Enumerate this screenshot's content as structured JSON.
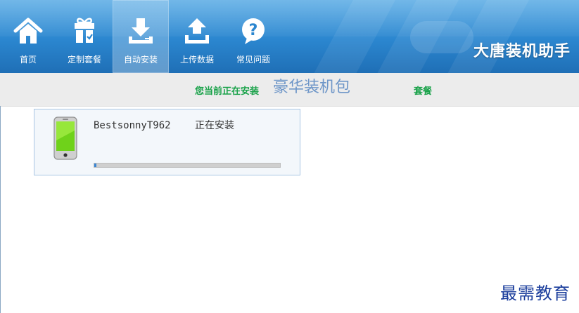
{
  "nav": {
    "items": [
      {
        "label": "首页",
        "icon": "home-icon"
      },
      {
        "label": "定制套餐",
        "icon": "gift-icon"
      },
      {
        "label": "自动安装",
        "icon": "download-icon",
        "active": true
      },
      {
        "label": "上传数据",
        "icon": "upload-icon"
      },
      {
        "label": "常见问题",
        "icon": "question-icon"
      }
    ]
  },
  "brand": "大唐装机助手",
  "status": {
    "prefix": "您当前正在安装",
    "package": "豪华装机包",
    "suffix": "套餐"
  },
  "device": {
    "name": "BestsonnyT962",
    "status": "正在安装",
    "icon": "phone-icon",
    "progress": 0.01
  },
  "watermark": "最需教育",
  "colors": {
    "topbar": "#2b86cf",
    "status_green": "#1aa24a",
    "package_blue": "#6e96c8",
    "progress_blue": "#3a86d4",
    "watermark_blue": "#1a3d9c"
  }
}
